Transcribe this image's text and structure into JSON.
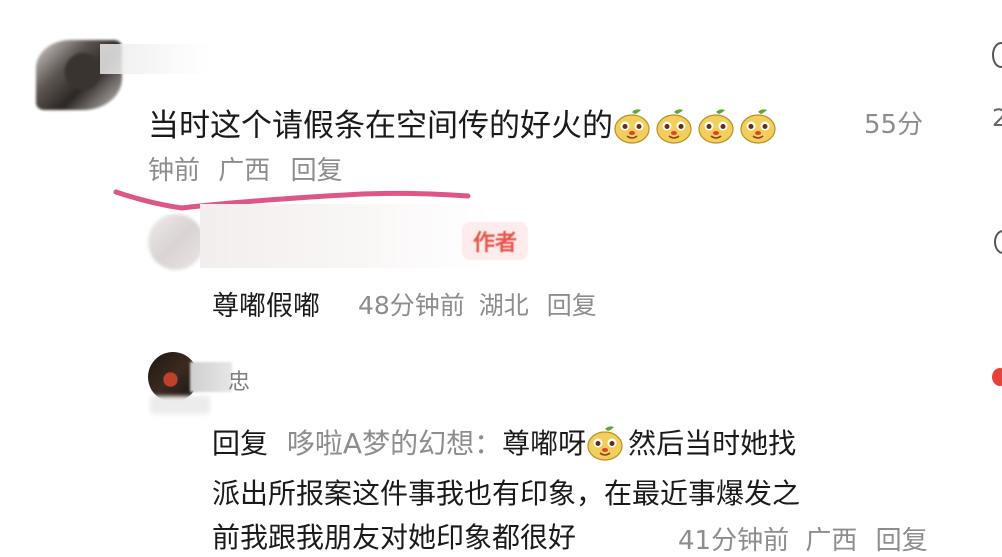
{
  "comments": {
    "main": {
      "text": "当时这个请假条在空间传的好火的",
      "emojis": [
        "pear-face-emoji",
        "pear-face-emoji",
        "pear-face-emoji",
        "pear-face-emoji"
      ],
      "time_part1": "55分",
      "time_part2": "钟前",
      "location": "广西",
      "reply_label": "回复"
    },
    "reply1": {
      "badge": "作者",
      "text": "尊嘟假嘟",
      "time": "48分钟前",
      "location": "湖北",
      "reply_label": "回复"
    },
    "reply2": {
      "username_tail": "忠",
      "prefix": "回复",
      "mention": "哆啦A梦的幻想：",
      "line1_a": "尊嘟呀",
      "line1_b": "然后当时她找",
      "line2": "派出所报案这件事我也有印象，在最近事爆发之",
      "line3": "前我跟我朋友对她印象都很好",
      "time": "41分钟前",
      "location": "广西",
      "reply_label": "回复"
    }
  },
  "edge": {
    "count_fragment": "2"
  },
  "colors": {
    "meta_gray": "#8d8d8d",
    "author_badge": "#e8574d",
    "doodle_pink": "#d8457a"
  }
}
